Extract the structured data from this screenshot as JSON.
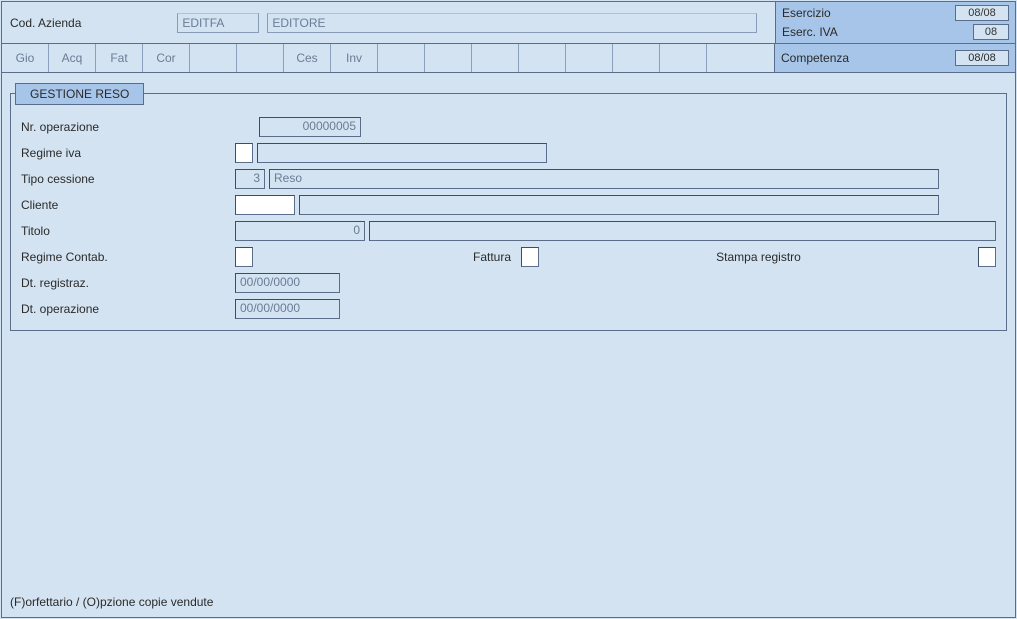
{
  "header": {
    "codAziendaLabel": "Cod. Azienda",
    "codAziendaCode": "EDITFA",
    "codAziendaDesc": "EDITORE",
    "esercizioLabel": "Esercizio",
    "esercizioVal": "08/08",
    "esercIvaLabel": "Eserc. IVA",
    "esercIvaVal": "08",
    "competenzaLabel": "Competenza",
    "competenzaVal": "08/08"
  },
  "tabs": [
    "Gio",
    "Acq",
    "Fat",
    "Cor",
    "",
    "",
    "Ces",
    "Inv",
    "",
    "",
    "",
    "",
    "",
    "",
    "",
    ""
  ],
  "panel": {
    "title": "GESTIONE RESO",
    "nrOperLabel": "Nr. operazione",
    "nrOperVal": "00000005",
    "regimeIvaLabel": "Regime iva",
    "regimeIvaCode": "",
    "regimeIvaDesc": "",
    "tipoCessLabel": "Tipo cessione",
    "tipoCessCode": "3",
    "tipoCessDesc": "Reso",
    "clienteLabel": "Cliente",
    "clienteCode": "",
    "clienteDesc": "",
    "titoloLabel": "Titolo",
    "titoloCode": "0",
    "titoloDesc": "",
    "regimeContabLabel": "Regime Contab.",
    "regimeContabCode": "",
    "fatturaLabel": "Fattura",
    "fatturaCode": "",
    "stampaRegLabel": "Stampa registro",
    "stampaRegCode": "",
    "dtRegistrazLabel": "Dt. registraz.",
    "dtRegistrazVal": "00/00/0000",
    "dtOperazLabel": "Dt. operazione",
    "dtOperazVal": "00/00/0000"
  },
  "status": "(F)orfettario / (O)pzione copie vendute"
}
